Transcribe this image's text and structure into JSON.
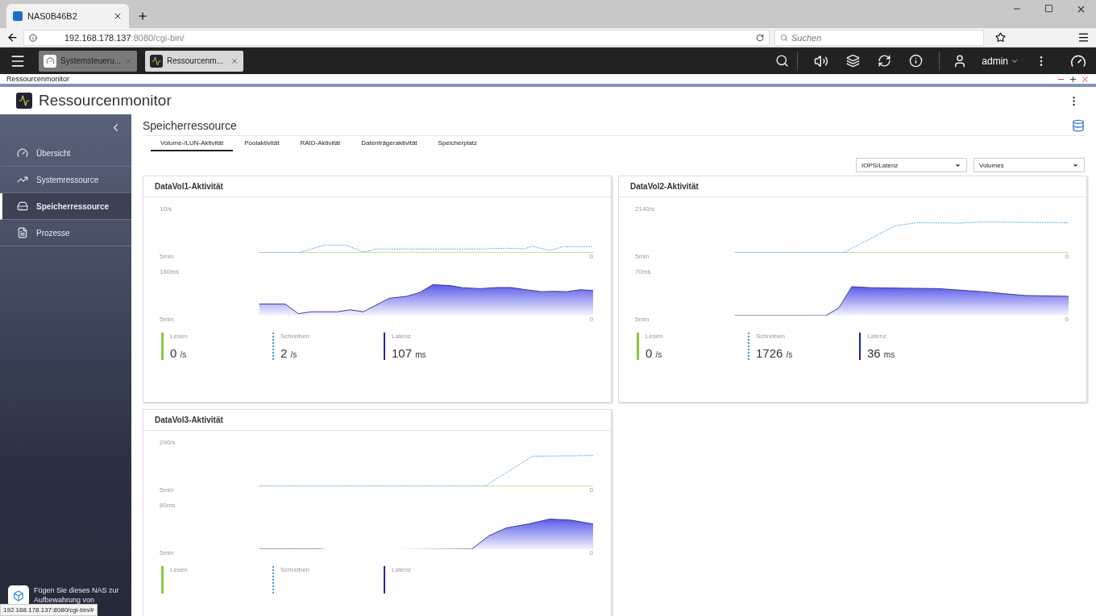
{
  "browser": {
    "tab": "NAS0B46B2",
    "url_host": "192.168.178.137",
    "url_rest": ":8080/cgi-bin/",
    "search_placeholder": "Suchen",
    "status_url": "192.168.178.137:8080/cgi-bin/#"
  },
  "nas_bar": {
    "tabs": [
      {
        "label": "Systemsteueru...",
        "selected": false
      },
      {
        "label": "Ressourcenm...",
        "selected": true
      }
    ],
    "user": "admin"
  },
  "window": {
    "title": "Ressourcenmonitor"
  },
  "app": {
    "title": "Ressourcenmonitor"
  },
  "sidebar": {
    "items": [
      {
        "label": "Übersicht",
        "selected": false
      },
      {
        "label": "Systemressource",
        "selected": false
      },
      {
        "label": "Speicherressource",
        "selected": true
      },
      {
        "label": "Prozesse",
        "selected": false
      }
    ],
    "promo": "Fügen Sie dieses NAS zur Aufbewahrung von"
  },
  "page": {
    "title": "Speicherressource",
    "tabs": [
      {
        "label": "Volume-/LUN-Aktivität",
        "selected": true
      },
      {
        "label": "Poolaktivität",
        "selected": false
      },
      {
        "label": "RAID-Aktivität",
        "selected": false
      },
      {
        "label": "Datenträgeraktivität",
        "selected": false
      },
      {
        "label": "Speicherplatz",
        "selected": false
      }
    ],
    "dropdowns": [
      "IOPS/Latenz",
      "Volumes"
    ]
  },
  "cards": [
    {
      "title": "DataVol1-Aktivität",
      "iops_chart": {
        "max": "10/s",
        "start": "5min",
        "end": "0"
      },
      "latency_chart": {
        "max": "160ms",
        "start": "5min",
        "end": "0"
      },
      "stats": [
        {
          "kind": "read",
          "label": "Lesen",
          "value": "0",
          "unit": "/s"
        },
        {
          "kind": "write",
          "label": "Schreiben",
          "value": "2",
          "unit": "/s"
        },
        {
          "kind": "latency",
          "label": "Latenz",
          "value": "107",
          "unit": "ms"
        }
      ]
    },
    {
      "title": "DataVol2-Aktivität",
      "iops_chart": {
        "max": "2140/s",
        "start": "5min",
        "end": "0"
      },
      "latency_chart": {
        "max": "70ms",
        "start": "5min",
        "end": "0"
      },
      "stats": [
        {
          "kind": "read",
          "label": "Lesen",
          "value": "0",
          "unit": "/s"
        },
        {
          "kind": "write",
          "label": "Schreiben",
          "value": "1726",
          "unit": "/s"
        },
        {
          "kind": "latency",
          "label": "Latenz",
          "value": "36",
          "unit": "ms"
        }
      ]
    },
    {
      "title": "DataVol3-Aktivität",
      "iops_chart": {
        "max": "290/s",
        "start": "5min",
        "end": "0"
      },
      "latency_chart": {
        "max": "80ms",
        "start": "5min",
        "end": "0"
      },
      "stats": [
        {
          "kind": "read",
          "label": "Lesen"
        },
        {
          "kind": "write",
          "label": "Schreiben"
        },
        {
          "kind": "latency",
          "label": "Latenz"
        }
      ]
    }
  ]
}
